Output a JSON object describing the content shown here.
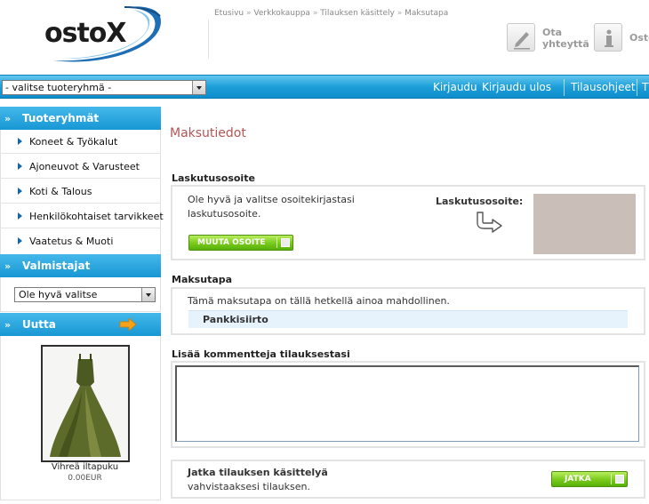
{
  "header": {
    "logo": "ostoX",
    "breadcrumb": [
      "Etusivu",
      "Verkkokauppa",
      "Tilauksen käsittely",
      "Maksutapa"
    ],
    "breadcrumb_sep": "»",
    "contact_line1": "Ota",
    "contact_line2": "yhteyttä",
    "extra_label": "Osto"
  },
  "nav": {
    "group_select": "- valitse tuoteryhmä -",
    "links": [
      "Kirjaudu",
      "Kirjaudu ulos",
      "Tilausohjeet",
      "T"
    ]
  },
  "sidebar": {
    "categories_title": "Tuoteryhmät",
    "categories": [
      "Koneet & Työkalut",
      "Ajoneuvot & Varusteet",
      "Koti & Talous",
      "Henkilökohtaiset tarvikkeet",
      "Vaatetus & Muoti"
    ],
    "makers_title": "Valmistajat",
    "makers_select": "Ole hyvä valitse",
    "new_title": "Uutta",
    "new_product_name": "Vihreä iltapuku",
    "new_product_price": "0.00EUR"
  },
  "main": {
    "title": "Maksutiedot",
    "billing": {
      "title": "Laskutusosoite",
      "text_line1": "Ole hyvä ja valitse osoitekirjastasi",
      "text_line2": "laskutusosoite.",
      "label": "Laskutusosoite:",
      "button": "MUUTA OSOITE"
    },
    "payment": {
      "title": "Maksutapa",
      "info": "Tämä maksutapa on tällä hetkellä ainoa mahdollinen.",
      "method": "Pankkisiirto"
    },
    "comments": {
      "title": "Lisää kommentteja tilauksestasi",
      "value": ""
    },
    "continue": {
      "title": "Jatka tilauksen käsittelyä",
      "subtitle": "vahvistaaksesi tilauksen.",
      "button": "JATKA"
    }
  },
  "colors": {
    "nav_blue": "#1d9fd9",
    "title_red": "#b35555",
    "button_green": "#7ccd1e",
    "address_placeholder": "#c9beb8"
  }
}
